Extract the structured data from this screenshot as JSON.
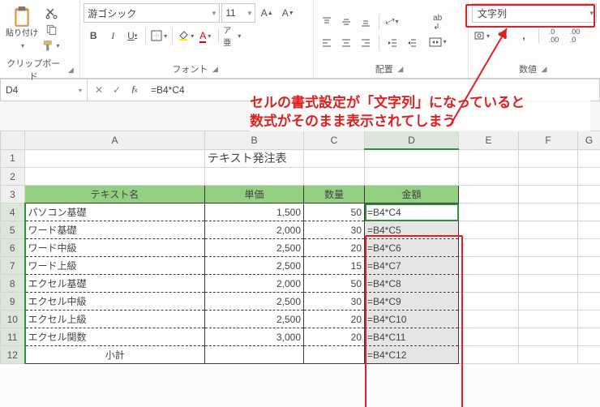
{
  "ribbon": {
    "groups": {
      "clipboard": {
        "label": "クリップボード",
        "paste": "貼り付け"
      },
      "font": {
        "label": "フォント",
        "font_name": "游ゴシック",
        "font_size": "11"
      },
      "alignment": {
        "label": "配置"
      },
      "number": {
        "label": "数値",
        "format_selected": "文字列"
      }
    }
  },
  "fx": {
    "name_box": "D4",
    "formula": "=B4*C4"
  },
  "callout": {
    "line1": "セルの書式設定が「文字列」になっていると",
    "line2": "数式がそのまま表示されてしまう"
  },
  "columns": [
    "A",
    "B",
    "C",
    "D",
    "E",
    "F",
    "G"
  ],
  "selected_col": "D",
  "selected_rows": [
    4,
    5,
    6,
    7,
    8,
    9,
    10,
    11,
    12
  ],
  "title_cell": "テキスト発注表",
  "headers": {
    "a": "テキスト名",
    "b": "単価",
    "c": "数量",
    "d": "金額"
  },
  "rows": [
    {
      "n": 4,
      "a": "パソコン基礎",
      "b": "1,500",
      "c": "50",
      "d": "=B4*C4"
    },
    {
      "n": 5,
      "a": "ワード基礎",
      "b": "2,000",
      "c": "30",
      "d": "=B4*C5"
    },
    {
      "n": 6,
      "a": "ワード中級",
      "b": "2,500",
      "c": "20",
      "d": "=B4*C6"
    },
    {
      "n": 7,
      "a": "ワード上級",
      "b": "2,500",
      "c": "15",
      "d": "=B4*C7"
    },
    {
      "n": 8,
      "a": "エクセル基礎",
      "b": "2,000",
      "c": "50",
      "d": "=B4*C8"
    },
    {
      "n": 9,
      "a": "エクセル中級",
      "b": "2,500",
      "c": "30",
      "d": "=B4*C9"
    },
    {
      "n": 10,
      "a": "エクセル上級",
      "b": "2,500",
      "c": "20",
      "d": "=B4*C10"
    },
    {
      "n": 11,
      "a": "エクセル関数",
      "b": "3,000",
      "c": "20",
      "d": "=B4*C11"
    },
    {
      "n": 12,
      "a": "小計",
      "b": "",
      "c": "",
      "d": "=B4*C12"
    }
  ]
}
